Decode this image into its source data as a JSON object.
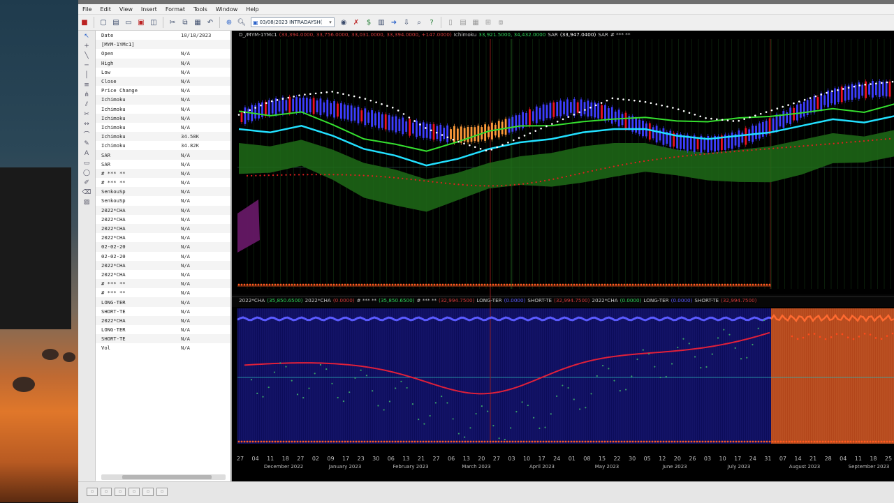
{
  "menu": [
    "File",
    "Edit",
    "View",
    "Insert",
    "Format",
    "Tools",
    "Window",
    "Help"
  ],
  "toolbar": {
    "symbol_interval": "03/08/2023 INTRADAYSH(",
    "icons": [
      "new-icon",
      "open-icon",
      "folder-icon",
      "print-icon",
      "chart-icon",
      "cut-icon",
      "copy-icon",
      "paste-icon",
      "undo-icon",
      "target-icon",
      "zoom-icon",
      "globe-icon",
      "strategy-icon",
      "dollar-icon",
      "portfolio-icon",
      "arrow-icon",
      "download-icon",
      "magnifier-icon",
      "help-icon",
      "layout-icon",
      "tile-icon",
      "grid-icon",
      "window-icon"
    ]
  },
  "data_window": {
    "rows": [
      {
        "label": "Date",
        "value": "10/18/2023"
      },
      {
        "label": "[MYM-1YMc1]",
        "value": ""
      },
      {
        "label": "Open",
        "value": "N/A"
      },
      {
        "label": "High",
        "value": "N/A"
      },
      {
        "label": "Low",
        "value": "N/A"
      },
      {
        "label": "Close",
        "value": "N/A"
      },
      {
        "label": "Price Change",
        "value": "N/A"
      },
      {
        "label": "Ichimoku",
        "value": "N/A"
      },
      {
        "label": "Ichimoku",
        "value": "N/A"
      },
      {
        "label": "Ichimoku",
        "value": "N/A"
      },
      {
        "label": "Ichimoku",
        "value": "N/A"
      },
      {
        "label": "Ichimoku",
        "value": "34.58K"
      },
      {
        "label": "Ichimoku",
        "value": "34.82K"
      },
      {
        "label": "SAR",
        "value": "N/A"
      },
      {
        "label": "SAR",
        "value": "N/A"
      },
      {
        "label": "# *** **",
        "value": "N/A"
      },
      {
        "label": "# *** **",
        "value": "N/A"
      },
      {
        "label": "SenkouSp",
        "value": "N/A"
      },
      {
        "label": "SenkouSp",
        "value": "N/A"
      },
      {
        "label": "2022*CHA",
        "value": "N/A"
      },
      {
        "label": "2022*CHA",
        "value": "N/A"
      },
      {
        "label": "2022*CHA",
        "value": "N/A"
      },
      {
        "label": "2022*CHA",
        "value": "N/A"
      },
      {
        "label": "02-02-20",
        "value": "N/A"
      },
      {
        "label": "02-02-20",
        "value": "N/A"
      },
      {
        "label": "2022*CHA",
        "value": "N/A"
      },
      {
        "label": "2022*CHA",
        "value": "N/A"
      },
      {
        "label": "# *** **",
        "value": "N/A"
      },
      {
        "label": "# *** **",
        "value": "N/A"
      },
      {
        "label": "LONG-TER",
        "value": "N/A"
      },
      {
        "label": "SHORT-TE",
        "value": "N/A"
      },
      {
        "label": "2022*CHA",
        "value": "N/A"
      },
      {
        "label": "LONG-TER",
        "value": "N/A"
      },
      {
        "label": "SHORT-TE",
        "value": "N/A"
      },
      {
        "label": "Vol",
        "value": "N/A"
      }
    ]
  },
  "price_pane": {
    "legend": [
      {
        "text": "D_/MYM-1YMc1",
        "color": "#c8c8c8"
      },
      {
        "text": "(33,394.0000, 33,756.0000, 33,031.0000, 33,394.0000, +147.0000)",
        "color": "#d23a3a"
      },
      {
        "text": "Ichimoku",
        "color": "#c8c8c8"
      },
      {
        "text": "33,921.5000, 34,432.0000",
        "color": "#2fd35a"
      },
      {
        "text": "SAR",
        "color": "#c8c8c8"
      },
      {
        "text": "(33,947.0400)",
        "color": "#ffffff"
      },
      {
        "text": "SAR",
        "color": "#c8c8c8"
      },
      {
        "text": "# *** **",
        "color": "#c8c8c8"
      }
    ]
  },
  "indicator_pane": {
    "legend": [
      {
        "text": "2022*CHA",
        "color": "#c8c8c8"
      },
      {
        "text": "(35,850.6500)",
        "color": "#2fd35a"
      },
      {
        "text": "2022*CHA",
        "color": "#c8c8c8"
      },
      {
        "text": "(0.0000)",
        "color": "#d23a3a"
      },
      {
        "text": "# *** **",
        "color": "#c8c8c8"
      },
      {
        "text": "(35,850.6500)",
        "color": "#2fd35a"
      },
      {
        "text": "# *** **",
        "color": "#c8c8c8"
      },
      {
        "text": "(32,994.7500)",
        "color": "#d23a3a"
      },
      {
        "text": "LONG-TER",
        "color": "#c8c8c8"
      },
      {
        "text": "(0.0000)",
        "color": "#5a5aff"
      },
      {
        "text": "SHORT-TE",
        "color": "#c8c8c8"
      },
      {
        "text": "(32,994.7500)",
        "color": "#d23a3a"
      },
      {
        "text": "2022*CHA",
        "color": "#c8c8c8"
      },
      {
        "text": "(0.0000)",
        "color": "#2fd35a"
      },
      {
        "text": "LONG-TER",
        "color": "#c8c8c8"
      },
      {
        "text": "(0.0000)",
        "color": "#5a5aff"
      },
      {
        "text": "SHORT-TE",
        "color": "#c8c8c8"
      },
      {
        "text": "(32,994.7500)",
        "color": "#d23a3a"
      }
    ]
  },
  "x_axis": {
    "day_ticks": [
      "27",
      "04",
      "11",
      "18",
      "27",
      "02",
      "09",
      "17",
      "23",
      "30",
      "06",
      "13",
      "21",
      "27",
      "06",
      "13",
      "20",
      "27",
      "03",
      "10",
      "17",
      "24",
      "01",
      "08",
      "15",
      "22",
      "30",
      "05",
      "12",
      "20",
      "26",
      "03",
      "10",
      "17",
      "24",
      "31",
      "07",
      "14",
      "21",
      "28",
      "04",
      "11",
      "18",
      "25"
    ],
    "months": [
      "December 2022",
      "January 2023",
      "February 2023",
      "March 2023",
      "April 2023",
      "May 2023",
      "June 2023",
      "July 2023",
      "August 2023",
      "September 2023"
    ]
  },
  "chart_data": {
    "type": "line",
    "series": [
      {
        "name": "Ichimoku",
        "values": [
          33950,
          33900,
          34000,
          33850,
          33650,
          33550,
          33400,
          33500,
          33650,
          33750,
          33800,
          33900,
          33950,
          33950,
          33850,
          33800,
          33850,
          33900,
          34000,
          34100,
          34050,
          34150
        ]
      },
      {
        "name": "SAR",
        "values": [
          33850,
          34050,
          34150,
          34200,
          34100,
          33950,
          33650,
          33450,
          33300,
          33500,
          33700,
          33900,
          34100,
          34050,
          33950,
          33800,
          33750,
          33900,
          34050,
          34200,
          34300,
          34350
        ]
      }
    ]
  },
  "colors": {
    "cloud_green": "#1f6b18",
    "kijun_cyan": "#22e0ff",
    "senkou_green": "#35e02f",
    "sar_white": "#ffffff",
    "tenkan_red": "#e21f1f",
    "candles_blue": "#3d3dff",
    "indicator_bg": "#0c0c5a",
    "indicator_bg_right": "#b3461a",
    "accent_orange": "#ff5a1f"
  }
}
